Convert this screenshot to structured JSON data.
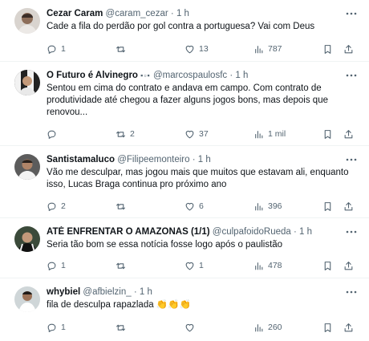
{
  "posts": [
    {
      "name": "Cezar Caram",
      "handle": "@caram_cezar",
      "dot": "·",
      "time": "1 h",
      "text": "Cade a fila do perdão por gol contra a portuguesa? Vai com Deus",
      "replies": "1",
      "reposts": "",
      "likes": "13",
      "views": "787"
    },
    {
      "name": "O Futuro é Alvinegro",
      "badge": "▪▫▪",
      "handle": "@marcospaulosfc",
      "dot": "·",
      "time": "1 h",
      "text": "Sentou em cima do contrato e andava em campo. Com contrato de produtividade até chegou a fazer alguns jogos bons, mas depois que renovou...",
      "replies": "",
      "reposts": "2",
      "likes": "37",
      "views": "1 mil"
    },
    {
      "name": "Santistamaluco",
      "handle": "@Filipeemonteiro",
      "dot": "·",
      "time": "1 h",
      "text": "Vão me desculpar, mas jogou mais que muitos que estavam ali, enquanto isso, Lucas Braga continua pro próximo ano",
      "replies": "2",
      "reposts": "",
      "likes": "6",
      "views": "396"
    },
    {
      "name": "ATÉ ENFRENTAR O AMAZONAS (1/1)",
      "handle": "@culpafoidoRueda",
      "dot": "·",
      "time": "1 h",
      "text": "Seria tão bom se essa notícia fosse logo após o paulistão",
      "replies": "1",
      "reposts": "",
      "likes": "1",
      "views": "478"
    },
    {
      "name": "whybiel",
      "handle": "@afbielzin_",
      "dot": "·",
      "time": "1 h",
      "text": "fila de desculpa rapazlada 👏👏👏",
      "replies": "1",
      "reposts": "",
      "likes": "",
      "views": "260"
    }
  ],
  "icons": {
    "more": "more-icon",
    "reply": "reply-icon",
    "repost": "repost-icon",
    "like": "heart-icon",
    "views": "views-icon",
    "bookmark": "bookmark-icon",
    "share": "share-icon"
  },
  "colors": {
    "text": "#0f1419",
    "secondary": "#536471",
    "divider": "#eff3f4",
    "clap": "#f6c342"
  }
}
